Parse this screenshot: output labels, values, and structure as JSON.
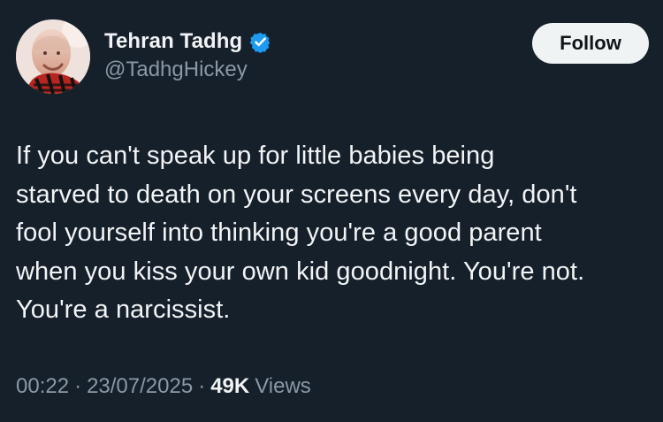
{
  "author": {
    "display_name": "Tehran Tadhg",
    "handle": "@TadhgHickey",
    "verified": true,
    "avatar_icon": "profile-photo"
  },
  "actions": {
    "follow_label": "Follow"
  },
  "tweet": {
    "text_lines": [
      "If you can't speak up for little babies being",
      "starved to death on your screens every day, don't",
      "fool yourself into thinking you're a good parent",
      "when you kiss your own kid goodnight. You're not.",
      "You're a narcissist."
    ]
  },
  "meta": {
    "time": "00:22",
    "separator": "·",
    "date": "23/07/2025",
    "views_count": "49K",
    "views_label": "Views"
  },
  "colors": {
    "background": "#15202b",
    "text": "#e7e9ea",
    "muted": "#8b98a5",
    "verified": "#1d9bf0",
    "follow_bg": "#eff3f4"
  }
}
